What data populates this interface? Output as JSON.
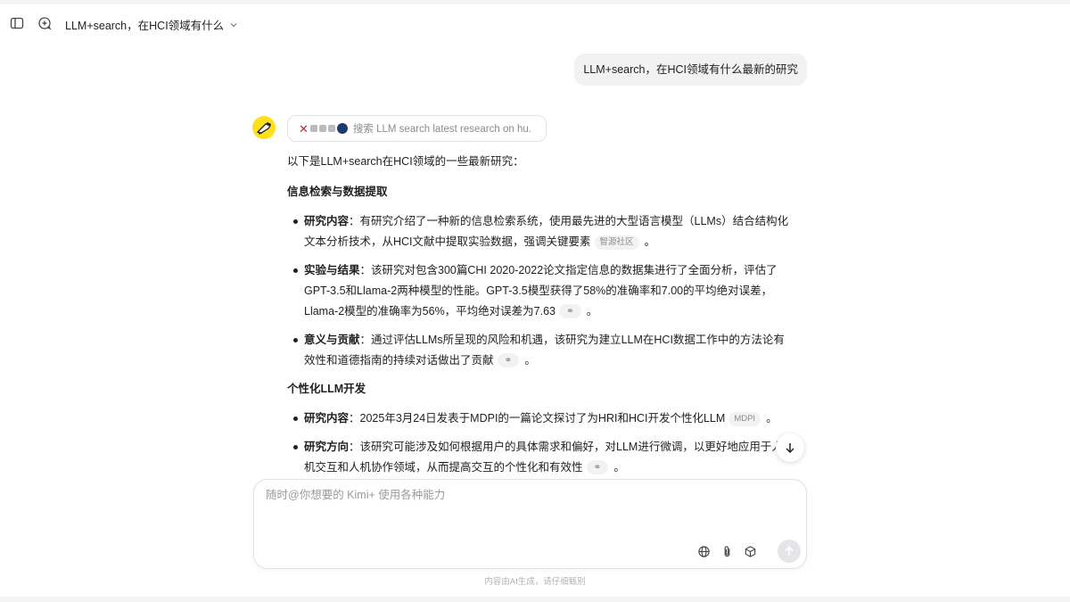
{
  "header": {
    "chat_title": "LLM+search，在HCI领域有什么"
  },
  "user_message": "LLM+search，在HCI领域有什么最新的研究",
  "assistant": {
    "search_label": "搜索 LLM search latest research on hu...",
    "intro": "以下是LLM+search在HCI领域的一些最新研究：",
    "sections": [
      {
        "heading": "信息检索与数据提取",
        "items": [
          {
            "label": "研究内容",
            "text": "：有研究介绍了一种新的信息检索系统，使用最先进的大型语言模型（LLMs）结合结构化文本分析技术，从HCI文献中提取实验数据，强调关键要素",
            "cite": "智源社区",
            "end": "。"
          },
          {
            "label": "实验与结果",
            "text": "：该研究对包含300篇CHI 2020-2022论文指定信息的数据集进行了全面分析，评估了GPT-3.5和Llama-2两种模型的性能。GPT-3.5模型获得了58%的准确率和7.00的平均绝对误差，Llama-2模型的准确率为56%，平均绝对误差为7.63",
            "cite": "⚭",
            "end": "。"
          },
          {
            "label": "意义与贡献",
            "text": "：通过评估LLMs所呈现的风险和机遇，该研究为建立LLM在HCI数据工作中的方法论有效性和道德指南的持续对话做出了贡献",
            "cite": "⚭",
            "end": "。"
          }
        ]
      },
      {
        "heading": "个性化LLM开发",
        "items": [
          {
            "label": "研究内容",
            "text": "：2025年3月24日发表于MDPI的一篇论文探讨了为HRI和HCI开发个性化LLM",
            "cite": "MDPI",
            "end": "。"
          },
          {
            "label": "研究方向",
            "text": "：该研究可能涉及如何根据用户的具体需求和偏好，对LLM进行微调，以更好地应用于人机交互和人机协作领域，从而提高交互的个性化和有效性",
            "cite": "⚭",
            "end": "。"
          }
        ]
      }
    ]
  },
  "composer": {
    "placeholder": "随时@你想要的 Kimi+ 使用各种能力"
  },
  "footer_note": "内容由AI生成，请仔细甄别",
  "icons": {
    "sidebar": "sidebar-toggle-icon",
    "new_chat": "new-chat-icon",
    "globe": "globe-icon",
    "attach": "paperclip-icon",
    "cube": "cube-icon",
    "send": "arrow-up-icon",
    "scroll": "arrow-down-icon"
  },
  "colors": {
    "accent_yellow": "#ffe01a",
    "bubble_bg": "#f2f2f3"
  }
}
